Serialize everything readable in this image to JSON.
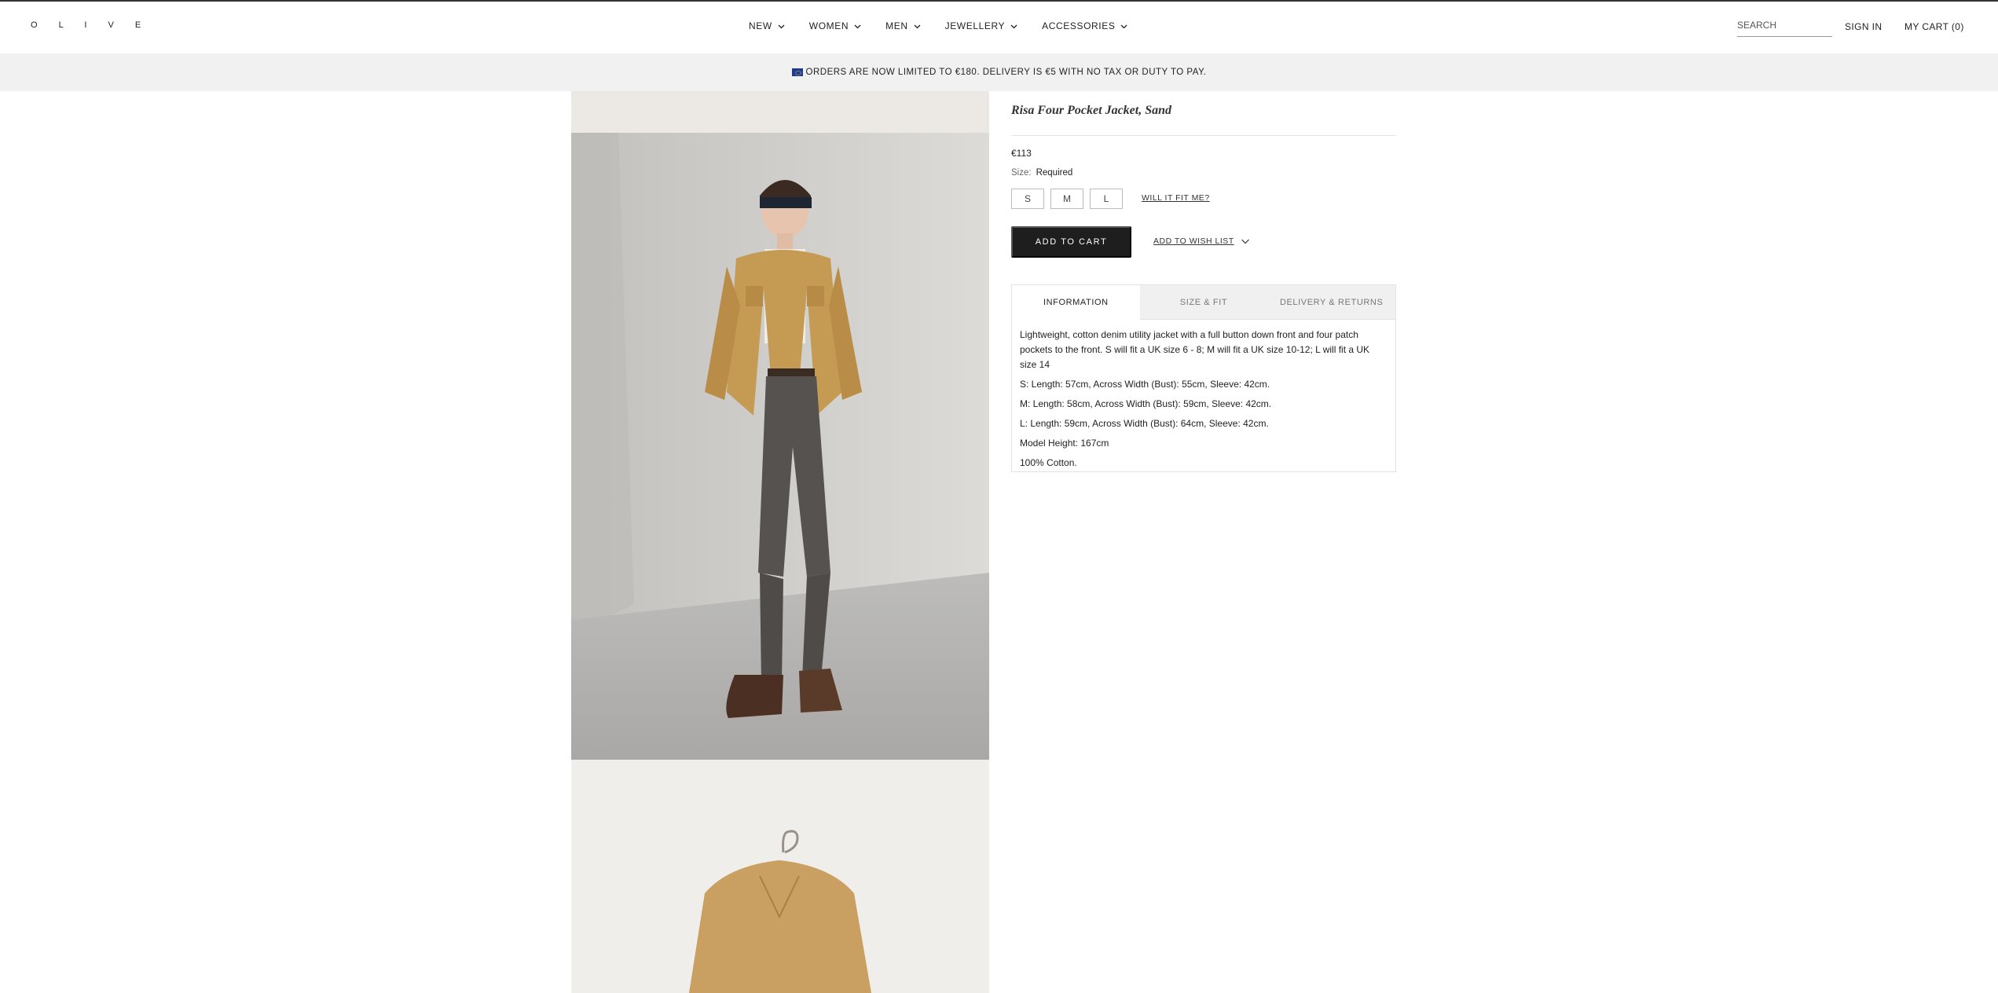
{
  "header": {
    "logo": "O L I V E",
    "nav": [
      {
        "label": "NEW"
      },
      {
        "label": "WOMEN"
      },
      {
        "label": "MEN"
      },
      {
        "label": "JEWELLERY"
      },
      {
        "label": "ACCESSORIES"
      }
    ],
    "search_placeholder": "SEARCH",
    "sign_in": "SIGN IN",
    "cart": "MY CART (0)"
  },
  "announcement": {
    "text": "ORDERS ARE NOW LIMITED TO €180. DELIVERY IS €5 WITH NO TAX OR DUTY TO PAY."
  },
  "product": {
    "title": "Risa Four Pocket Jacket, Sand",
    "price": "€113",
    "size_label": "Size:",
    "size_required": "Required",
    "sizes": [
      "S",
      "M",
      "L"
    ],
    "fit_link": "WILL IT FIT ME?",
    "add_to_cart": "ADD TO CART",
    "wishlist": "ADD TO WISH LIST"
  },
  "tabs": [
    {
      "label": "INFORMATION",
      "active": true
    },
    {
      "label": "SIZE & FIT",
      "active": false
    },
    {
      "label": "DELIVERY & RETURNS",
      "active": false
    }
  ],
  "information": [
    "Lightweight, cotton denim utility jacket with a full button down front and four patch pockets to the front. S will fit a UK size 6 - 8; M will fit a UK size 10-12; L will fit a UK size 14",
    "S: Length: 57cm, Across Width (Bust): 55cm, Sleeve: 42cm.",
    "M: Length: 58cm, Across Width (Bust): 59cm, Sleeve: 42cm.",
    "L: Length: 59cm, Across Width (Bust): 64cm, Sleeve: 42cm.",
    "Model Height: 167cm",
    "100% Cotton."
  ],
  "icons": {
    "nav_chevron": "chevron-down-icon",
    "wishlist_chevron": "chevron-down-icon",
    "flag": "eu-flag-icon"
  }
}
